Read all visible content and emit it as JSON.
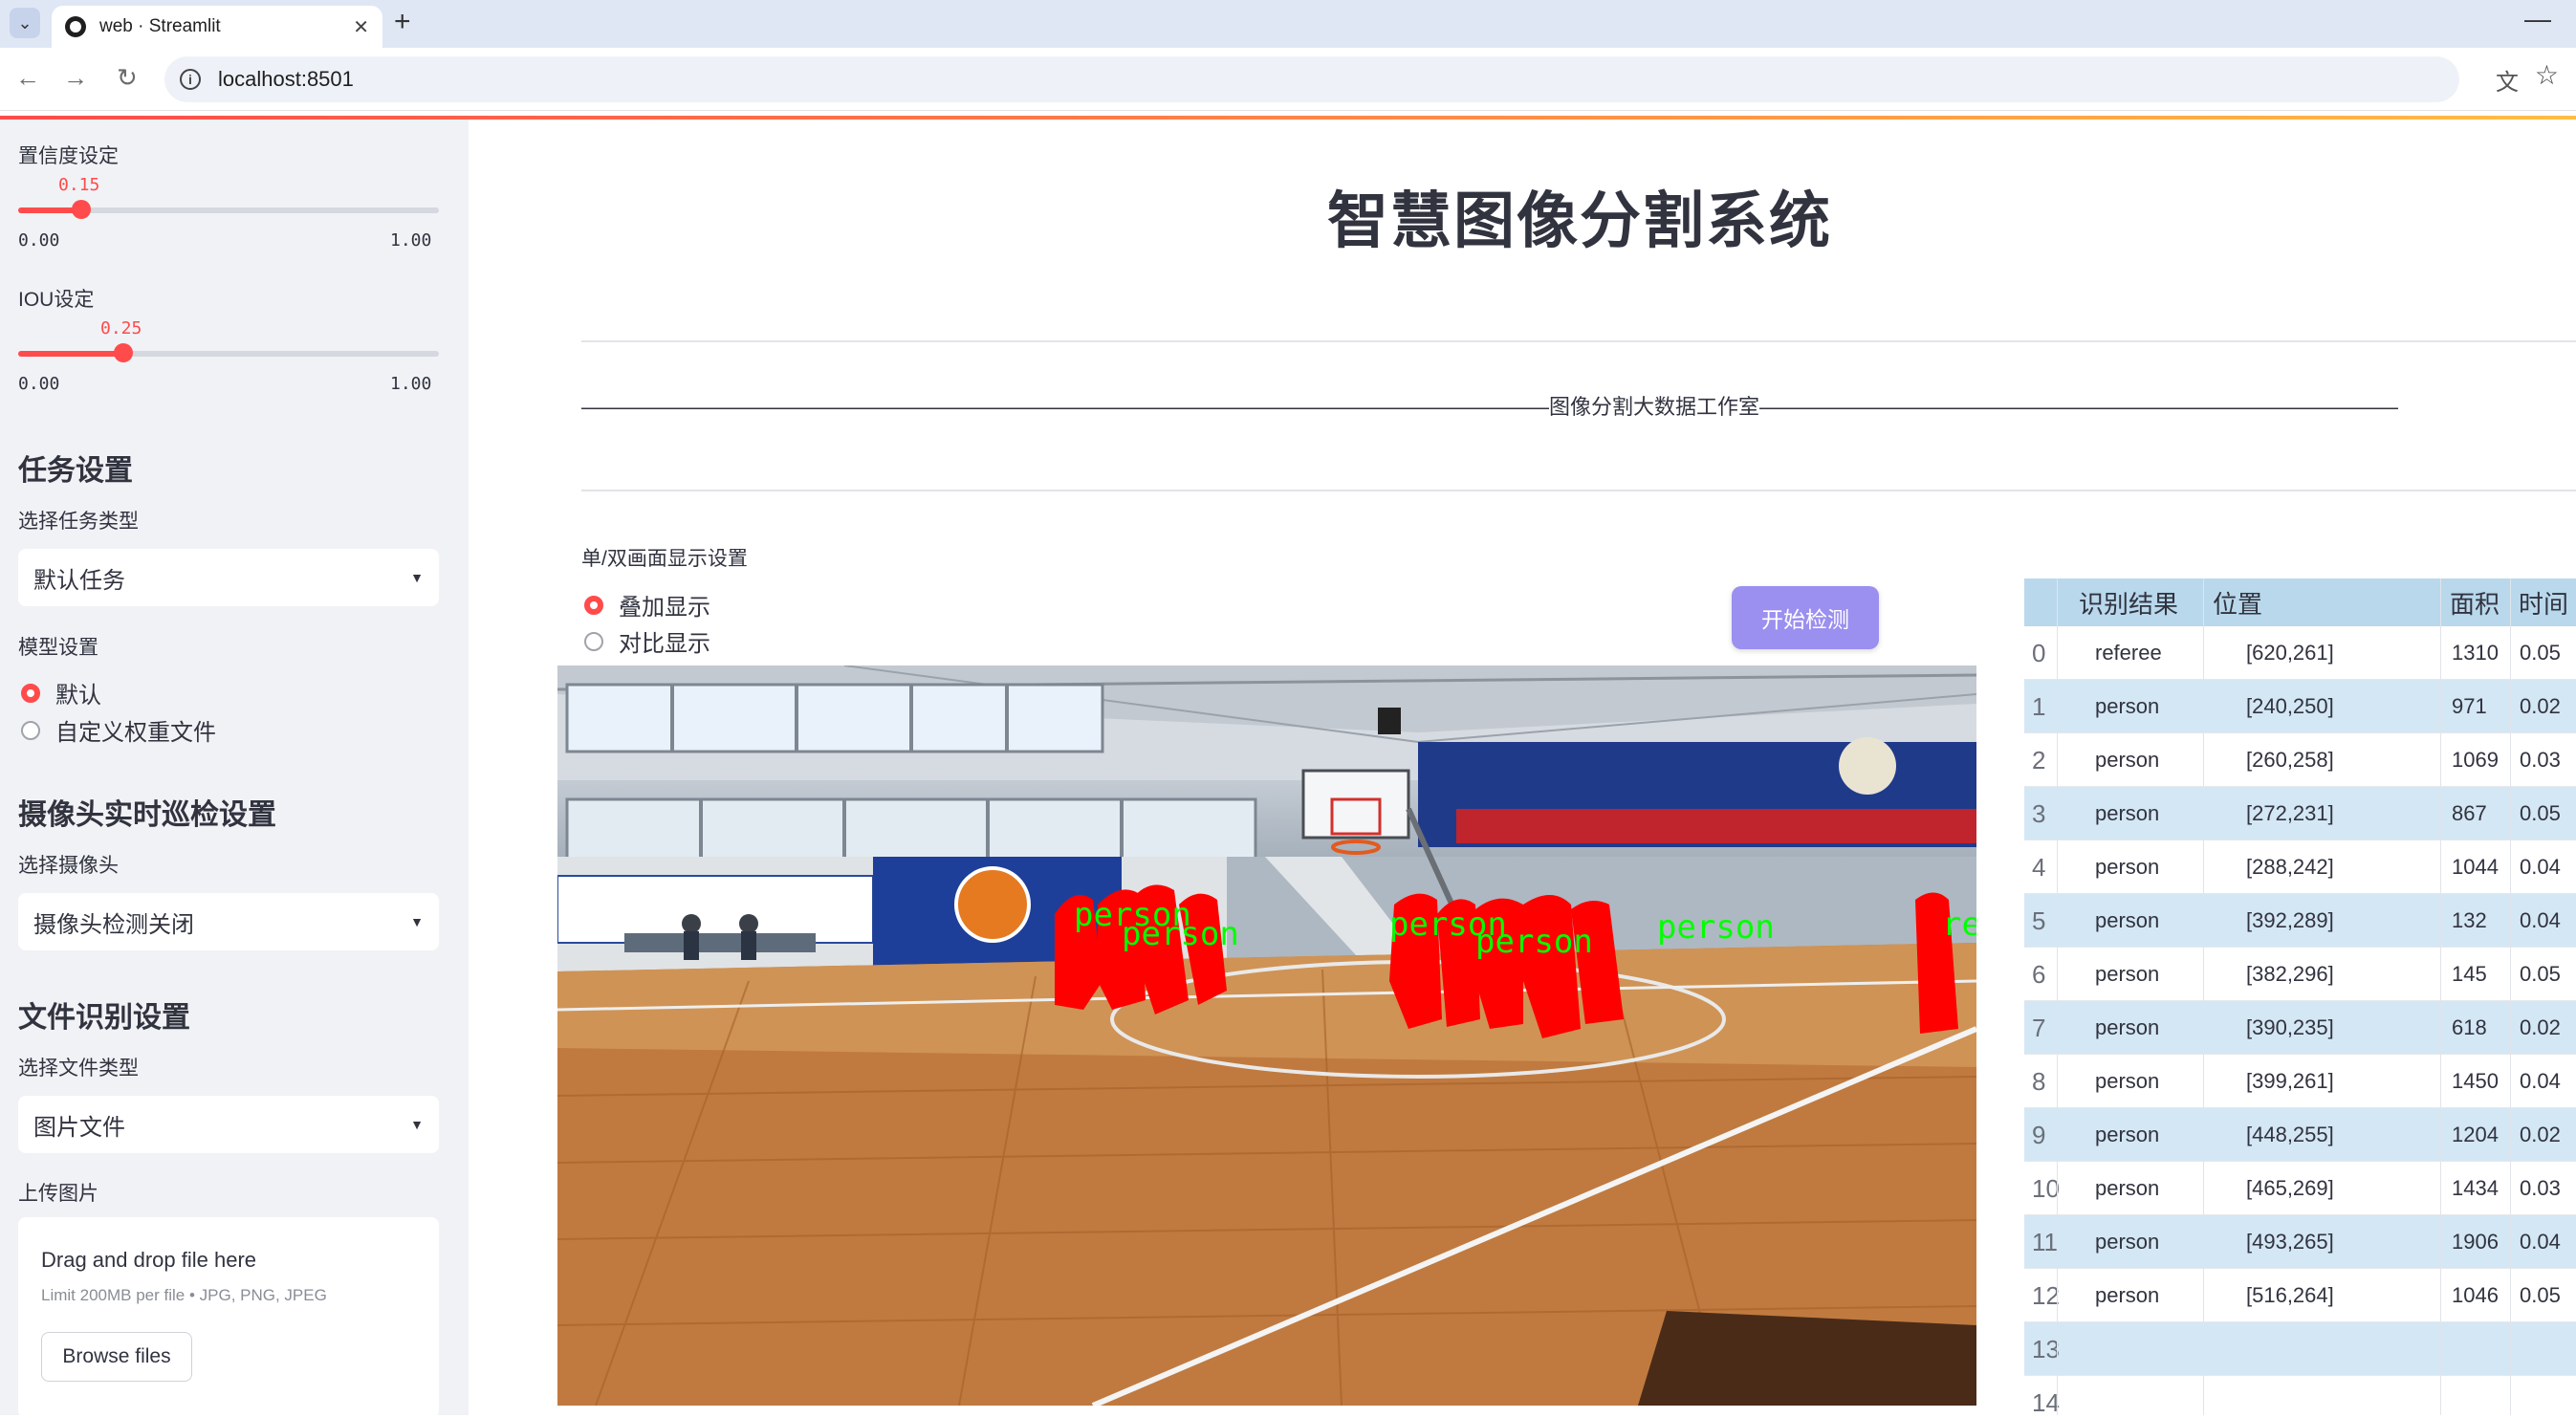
{
  "browser": {
    "tab_title": "web · Streamlit",
    "url": "localhost:8501"
  },
  "sidebar": {
    "confidence": {
      "label": "置信度设定",
      "value": "0.15",
      "fraction": 0.15,
      "min": "0.00",
      "max": "1.00"
    },
    "iou": {
      "label": "IOU设定",
      "value": "0.25",
      "fraction": 0.25,
      "min": "0.00",
      "max": "1.00"
    },
    "task": {
      "heading": "任务设置",
      "label": "选择任务类型",
      "selected": "默认任务"
    },
    "model": {
      "label": "模型设置",
      "options": [
        "默认",
        "自定义权重文件"
      ],
      "selected_index": 0
    },
    "camera": {
      "heading": "摄像头实时巡检设置",
      "label": "选择摄像头",
      "selected": "摄像头检测关闭"
    },
    "file": {
      "heading": "文件识别设置",
      "label": "选择文件类型",
      "selected": "图片文件"
    },
    "upload": {
      "label": "上传图片",
      "title": "Drag and drop file here",
      "subtitle": "Limit 200MB per file • JPG, PNG, JPEG",
      "button": "Browse files"
    }
  },
  "main": {
    "title": "智慧图像分割系统",
    "divider_text": "——————————————————————————————————————————————图像分割大数据工作室——————————————————————————————————————————————",
    "display_label": "单/双画面显示设置",
    "display_options": [
      "叠加显示",
      "对比显示"
    ],
    "display_selected_index": 0,
    "start_button": "开始检测"
  },
  "overlay_labels": [
    "person",
    "person",
    "person",
    "person",
    "person",
    "re"
  ],
  "colors": {
    "accent": "#ff4b4b",
    "button": "#9b8ff0",
    "table_header": "#b9d8ec",
    "table_alt": "#d4e7f4",
    "mask": "#ff0000",
    "label": "#00ff00"
  },
  "table": {
    "headers": [
      "识别结果",
      "位置",
      "面积",
      "时间"
    ],
    "rows": [
      {
        "idx": "0",
        "label": "referee",
        "pos": "[620,261]",
        "area": "1310",
        "time": "0.05"
      },
      {
        "idx": "1",
        "label": "person",
        "pos": "[240,250]",
        "area": "971",
        "time": "0.02"
      },
      {
        "idx": "2",
        "label": "person",
        "pos": "[260,258]",
        "area": "1069",
        "time": "0.03"
      },
      {
        "idx": "3",
        "label": "person",
        "pos": "[272,231]",
        "area": "867",
        "time": "0.05"
      },
      {
        "idx": "4",
        "label": "person",
        "pos": "[288,242]",
        "area": "1044",
        "time": "0.04"
      },
      {
        "idx": "5",
        "label": "person",
        "pos": "[392,289]",
        "area": "132",
        "time": "0.04"
      },
      {
        "idx": "6",
        "label": "person",
        "pos": "[382,296]",
        "area": "145",
        "time": "0.05"
      },
      {
        "idx": "7",
        "label": "person",
        "pos": "[390,235]",
        "area": "618",
        "time": "0.02"
      },
      {
        "idx": "8",
        "label": "person",
        "pos": "[399,261]",
        "area": "1450",
        "time": "0.04"
      },
      {
        "idx": "9",
        "label": "person",
        "pos": "[448,255]",
        "area": "1204",
        "time": "0.02"
      },
      {
        "idx": "10",
        "label": "person",
        "pos": "[465,269]",
        "area": "1434",
        "time": "0.03"
      },
      {
        "idx": "11",
        "label": "person",
        "pos": "[493,265]",
        "area": "1906",
        "time": "0.04"
      },
      {
        "idx": "12",
        "label": "person",
        "pos": "[516,264]",
        "area": "1046",
        "time": "0.05"
      },
      {
        "idx": "13",
        "label": "",
        "pos": "",
        "area": "",
        "time": ""
      },
      {
        "idx": "14",
        "label": "",
        "pos": "",
        "area": "",
        "time": ""
      }
    ]
  }
}
